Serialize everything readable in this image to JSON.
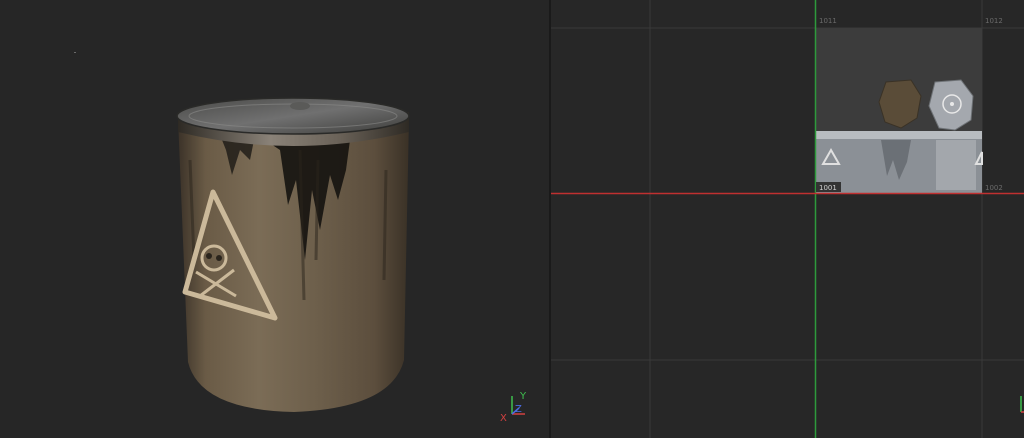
{
  "viewport_3d": {
    "label_symbol": "skull-and-crossbones-warning",
    "gizmo": {
      "x_label": "X",
      "y_label": "Y",
      "z_label": "Z"
    }
  },
  "uv_editor": {
    "tiles": {
      "tile_1001": "1001",
      "tile_1011": "1011",
      "tile_1012": "1012",
      "tile_1002": "1002"
    },
    "colors": {
      "u_axis": "#c03030",
      "v_axis": "#2e9a3c",
      "grid": "#3a3a3a"
    }
  }
}
